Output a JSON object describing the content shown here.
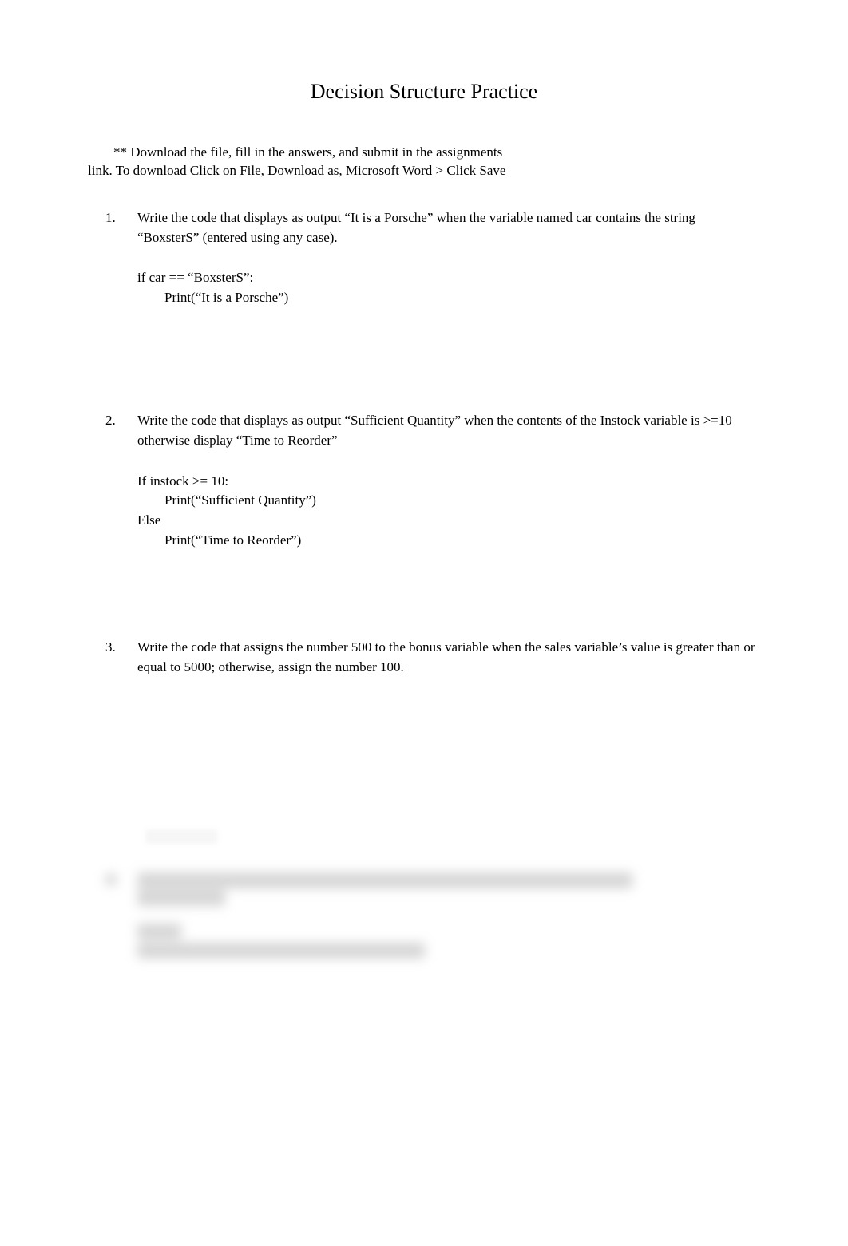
{
  "title": "Decision Structure Practice",
  "instructions": {
    "line1": "** Download the file, fill in the answers, and submit in the assignments",
    "line2": "link. To download Click on File, Download as, Microsoft Word > Click Save"
  },
  "questions": [
    {
      "number": "1.",
      "text": "Write the code that displays as output “It is a Porsche” when the variable named car contains the string “BoxsterS” (entered using any case).",
      "answer": "if car == “BoxsterS”:\n        Print(“It is a Porsche”)"
    },
    {
      "number": "2.",
      "text": "Write the code that displays as output “Sufficient Quantity” when the contents of the Instock variable is >=10 otherwise display “Time to Reorder”",
      "answer": "If instock >= 10:\n        Print(“Sufficient Quantity”)\nElse\n        Print(“Time to Reorder”)"
    },
    {
      "number": "3.",
      "text": "Write the code that assigns the number 500 to the bonus variable when the sales variable’s value is greater than or equal to 5000; otherwise, assign the number 100.",
      "answer": ""
    }
  ]
}
